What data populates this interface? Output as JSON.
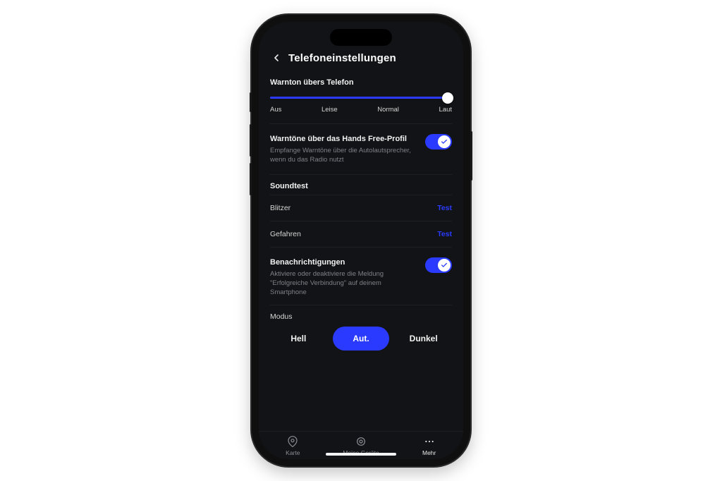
{
  "header": {
    "title": "Telefoneinstellungen"
  },
  "volume": {
    "section_label": "Warnton übers Telefon",
    "labels": {
      "off": "Aus",
      "quiet": "Leise",
      "normal": "Normal",
      "loud": "Laut"
    },
    "value_index": 3
  },
  "handsfree": {
    "title": "Warntöne über das Hands Free-Profil",
    "subtitle": "Empfange Warntöne über die Autolautsprecher, wenn du das Radio nutzt",
    "enabled": true
  },
  "soundtest": {
    "header": "Soundtest",
    "test_label": "Test",
    "items": [
      {
        "name": "Blitzer"
      },
      {
        "name": "Gefahren"
      }
    ]
  },
  "notifications": {
    "title": "Benachrichtigungen",
    "subtitle": "Aktiviere oder deaktiviere die Meldung \"Erfolgreiche Verbindung\" auf deinem Smartphone",
    "enabled": true
  },
  "mode": {
    "label": "Modus",
    "options": {
      "light": "Hell",
      "auto": "Aut.",
      "dark": "Dunkel"
    },
    "selected": "auto"
  },
  "tabbar": {
    "map": "Karte",
    "devices": "Meine Geräte",
    "more": "Mehr"
  }
}
